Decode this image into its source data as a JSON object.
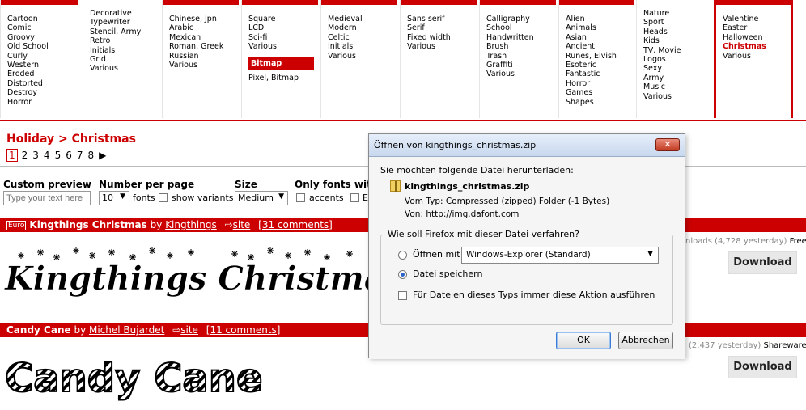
{
  "categories": {
    "col1": [
      "Cartoon",
      "Comic",
      "Groovy",
      "Old School",
      "Curly",
      "Western",
      "Eroded",
      "Distorted",
      "Destroy",
      "Horror"
    ],
    "col2": [
      "Decorative",
      "Typewriter",
      "Stencil, Army",
      "Retro",
      "Initials",
      "Grid",
      "Various"
    ],
    "col3": [
      "Chinese, Jpn",
      "Arabic",
      "Mexican",
      "Roman, Greek",
      "Russian",
      "Various"
    ],
    "col4": [
      "Square",
      "LCD",
      "Sci-fi",
      "Various"
    ],
    "col4_sub_heading": "Bitmap",
    "col4_sub": [
      "Pixel, Bitmap"
    ],
    "col5": [
      "Medieval",
      "Modern",
      "Celtic",
      "Initials",
      "Various"
    ],
    "col6": [
      "Sans serif",
      "Serif",
      "Fixed width",
      "Various"
    ],
    "col7": [
      "Calligraphy",
      "School",
      "Handwritten",
      "Brush",
      "Trash",
      "Graffiti",
      "Various"
    ],
    "col8": [
      "Alien",
      "Animals",
      "Asian",
      "Ancient",
      "Runes, Elvish",
      "Esoteric",
      "Fantastic",
      "Horror",
      "Games",
      "Shapes"
    ],
    "col9": [
      "Nature",
      "Sport",
      "Heads",
      "Kids",
      "TV, Movie",
      "Logos",
      "Sexy",
      "Army",
      "Music",
      "Various"
    ],
    "col10": [
      "Valentine",
      "Easter",
      "Halloween",
      "Christmas",
      "Various"
    ]
  },
  "breadcrumb": "Holiday > Christmas",
  "pager": {
    "current": "1",
    "pages": [
      "2",
      "3",
      "4",
      "5",
      "6",
      "7",
      "8"
    ],
    "next": "▶"
  },
  "filters": {
    "custom_preview_label": "Custom preview",
    "custom_preview_placeholder": "Type your text here",
    "number_per_page_label": "Number per page",
    "number_per_page_value": "10",
    "fonts_label": "fonts",
    "show_variants_label": "show variants",
    "size_label": "Size",
    "size_value": "Medium",
    "only_fonts_with_label": "Only fonts with",
    "accents_label": "accents",
    "trailing_cut": "E"
  },
  "fonts": [
    {
      "badge": "Euro",
      "name": "Kingthings Christmas",
      "by": "by",
      "author": "Kingthings",
      "site_label": "site",
      "comments": "[31 comments]",
      "downloads_prefix": "nloads",
      "downloads_yesterday": "(4,728 yesterday)",
      "license": "Free",
      "download_label": "Download",
      "preview_text": "Kingthings Christmas"
    },
    {
      "name": "Candy Cane",
      "by": "by",
      "author": "Michel Bujardet",
      "site_label": "site",
      "comments": "[11 comments]",
      "downloads_yesterday": "(2,437 yesterday)",
      "license": "Shareware",
      "download_label": "Download",
      "preview_text": "Candy Cane"
    }
  ],
  "dialog": {
    "title": "Öffnen von kingthings_christmas.zip",
    "close_glyph": "✕",
    "question": "Sie möchten folgende Datei herunterladen:",
    "filename": "kingthings_christmas.zip",
    "type_key": "Vom Typ:",
    "type_value": "Compressed (zipped) Folder (-1 Bytes)",
    "from_key": "Von:",
    "from_value": "http://img.dafont.com",
    "group_title": "Wie soll Firefox mit dieser Datei verfahren?",
    "open_with_label": "Öffnen mit",
    "open_with_value": "Windows-Explorer (Standard)",
    "save_label": "Datei speichern",
    "always_label": "Für Dateien dieses Typs immer diese Aktion ausführen",
    "ok_label": "OK",
    "cancel_label": "Abbrechen"
  },
  "colors": {
    "accent": "#cc0000",
    "dialog_title_bg": "#c8d8ee"
  }
}
